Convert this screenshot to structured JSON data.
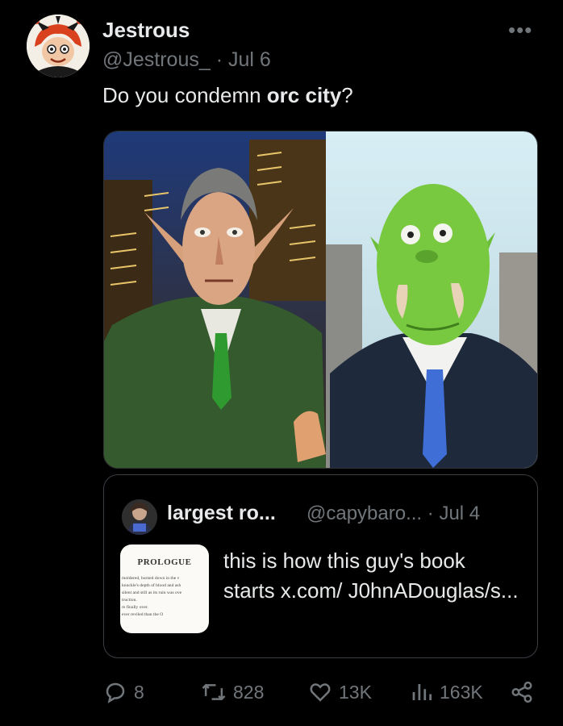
{
  "tweet": {
    "display_name": "Jestrous",
    "handle": "@Jestrous_",
    "separator": "·",
    "date": "Jul 6",
    "text_prefix": "Do you condemn ",
    "text_bold": "orc city",
    "text_suffix": "?"
  },
  "quote": {
    "display_name": "largest ro...",
    "handle": "@capybaro...",
    "separator": "·",
    "date": "Jul 4",
    "text": "this is how this guy's book starts  x.com/ J0hnADouglas/s...",
    "thumbnail": {
      "heading": "PROLOGUE",
      "lines": [
        "moldered, burned down in the v",
        "knuckle's depth of blood and ash",
        "silent and still as its ruin was ove",
        "truction.",
        "re finally over.",
        "ever reviled than the O"
      ]
    }
  },
  "actions": {
    "replies": "8",
    "reposts": "828",
    "likes": "13K",
    "views": "163K"
  },
  "icons": {
    "more": "more-options-icon",
    "reply": "reply-icon",
    "repost": "repost-icon",
    "like": "heart-icon",
    "views": "views-icon",
    "share": "share-icon"
  },
  "colors": {
    "background": "#000000",
    "text": "#e7e9ea",
    "muted": "#71767b",
    "border": "#2f3336"
  }
}
